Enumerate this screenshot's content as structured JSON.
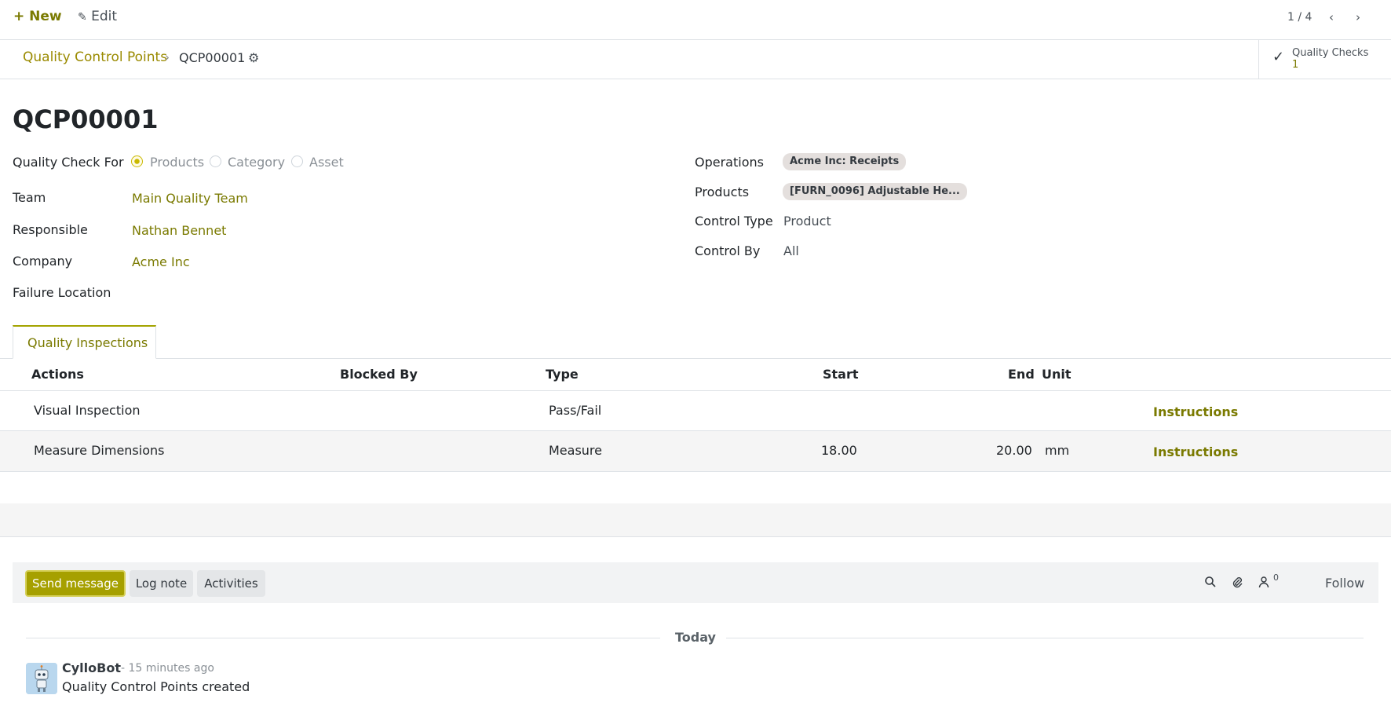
{
  "topbar": {
    "new_label": "+ New",
    "edit_icon": "edit-icon",
    "edit_label": "Edit",
    "pager": "1 / 4"
  },
  "breadcrumb": {
    "parent": "Quality Control Points",
    "current": "QCP00001"
  },
  "smart_button": {
    "label": "Quality Checks",
    "count": "1"
  },
  "record": {
    "title": "QCP00001",
    "left_fields": {
      "check_for_label": "Quality Check For",
      "check_for_options": [
        "Products",
        "Category",
        "Asset"
      ],
      "check_for_selected": "Products",
      "team_label": "Team",
      "team_value": "Main Quality Team",
      "responsible_label": "Responsible",
      "responsible_value": "Nathan Bennet",
      "company_label": "Company",
      "company_value": "Acme Inc",
      "failure_location_label": "Failure Location"
    },
    "right_fields": {
      "operations_label": "Operations",
      "operations_tag": "Acme Inc: Receipts",
      "products_label": "Products",
      "products_tag": "[FURN_0096] Adjustable He...",
      "control_type_label": "Control Type",
      "control_type_value": "Product",
      "control_by_label": "Control By",
      "control_by_value": "All"
    }
  },
  "tabs": [
    {
      "label": "Quality Inspections",
      "active": true
    }
  ],
  "table": {
    "headers": {
      "actions": "Actions",
      "blocked_by": "Blocked By",
      "type": "Type",
      "start": "Start",
      "end": "End",
      "unit": "Unit"
    },
    "rows": [
      {
        "action": "Visual Inspection",
        "blocked_by": "",
        "type": "Pass/Fail",
        "start": "",
        "end": "",
        "unit": "",
        "link": "Instructions"
      },
      {
        "action": "Measure Dimensions",
        "blocked_by": "",
        "type": "Measure",
        "start": "18.00",
        "end": "20.00",
        "unit": "mm",
        "link": "Instructions"
      }
    ]
  },
  "chatter": {
    "send_message": "Send message",
    "log_note": "Log note",
    "activities": "Activities",
    "followers_count": "0",
    "follow": "Follow",
    "date_separator": "Today",
    "messages": [
      {
        "author": "CylloBot",
        "time": "- 15 minutes ago",
        "body": "Quality Control Points created"
      }
    ]
  },
  "colors": {
    "accent": "#7a7a00",
    "send_button": "#a6a000",
    "tag_bg": "#e4dfdd"
  }
}
